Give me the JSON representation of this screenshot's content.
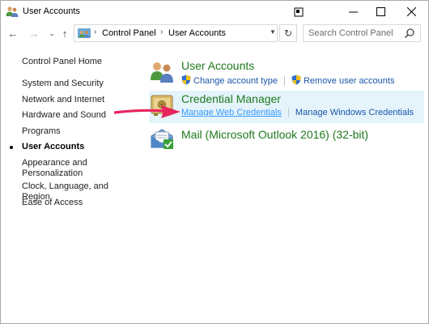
{
  "window": {
    "title": "User Accounts",
    "help_icon": "help-window-icon",
    "min_icon": "minimize-icon",
    "max_icon": "maximize-icon",
    "close_icon": "close-icon"
  },
  "nav": {
    "back_icon": "arrow-left-icon",
    "forward_icon": "arrow-right-icon",
    "recent_icon": "chevron-down-icon",
    "up_icon": "arrow-up-icon",
    "breadcrumb": [
      "Control Panel",
      "User Accounts"
    ],
    "refresh_icon": "refresh-icon",
    "search_placeholder": "Search Control Panel"
  },
  "sidebar": {
    "items": [
      {
        "label": "Control Panel Home"
      },
      {
        "label": "System and Security"
      },
      {
        "label": "Network and Internet"
      },
      {
        "label": "Hardware and Sound"
      },
      {
        "label": "Programs"
      },
      {
        "label": "User Accounts",
        "active": true
      },
      {
        "label": "Appearance and Personalization"
      },
      {
        "label": "Clock, Language, and Region"
      },
      {
        "label": "Ease of Access"
      }
    ]
  },
  "main": {
    "categories": [
      {
        "title": "User Accounts",
        "icon": "users-icon",
        "links": [
          "Change account type",
          "Remove user accounts"
        ]
      },
      {
        "title": "Credential Manager",
        "icon": "credential-vault-icon",
        "links": [
          "Manage Web Credentials",
          "Manage Windows Credentials"
        ]
      },
      {
        "title": "Mail (Microsoft Outlook 2016) (32-bit)",
        "icon": "mail-icon",
        "links": []
      }
    ]
  },
  "colors": {
    "category_title": "#1e7a1e",
    "link": "#1a56a8",
    "link_hover": "#3399ff",
    "highlight": "#e5f3fb",
    "annotation_arrow": "#e8245f"
  }
}
